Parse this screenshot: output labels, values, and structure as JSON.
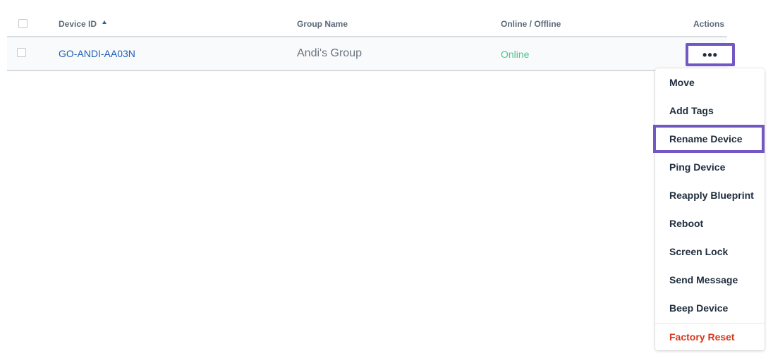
{
  "table": {
    "headers": {
      "device_id": "Device ID",
      "group_name": "Group Name",
      "status": "Online / Offline",
      "actions": "Actions"
    },
    "rows": [
      {
        "device_id": "GO-ANDI-AA03N",
        "group_name": "Andi's Group",
        "status": "Online",
        "actions_label": "•••"
      }
    ]
  },
  "menu": {
    "items": [
      {
        "label": "Move"
      },
      {
        "label": "Add Tags"
      },
      {
        "label": "Rename Device"
      },
      {
        "label": "Ping Device"
      },
      {
        "label": "Reapply Blueprint"
      },
      {
        "label": "Reboot"
      },
      {
        "label": "Screen Lock"
      },
      {
        "label": "Send Message"
      },
      {
        "label": "Beep Device"
      },
      {
        "label": "Factory Reset"
      }
    ]
  },
  "colors": {
    "link": "#1d5fb5",
    "online": "#4ec48c",
    "highlight": "#7358c4",
    "danger": "#d9361e"
  }
}
